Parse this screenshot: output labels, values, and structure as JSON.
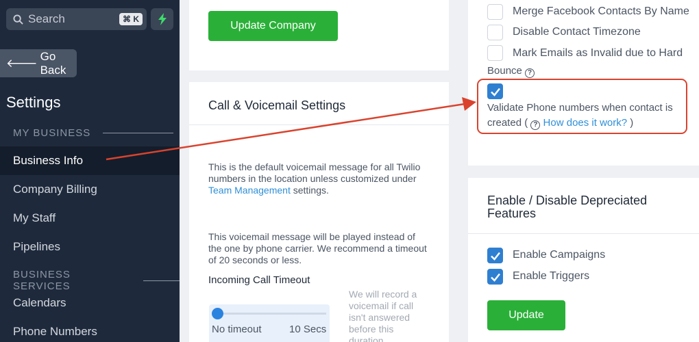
{
  "sidebar": {
    "search_placeholder": "Search",
    "search_shortcut": "⌘ K",
    "go_back": "Go Back",
    "settings_title": "Settings",
    "section_my_business": "MY BUSINESS",
    "section_business_services": "BUSINESS SERVICES",
    "items": [
      {
        "label": "Business Info",
        "active": true
      },
      {
        "label": "Company Billing"
      },
      {
        "label": "My Staff"
      },
      {
        "label": "Pipelines"
      },
      {
        "label": "Calendars"
      },
      {
        "label": "Phone Numbers"
      }
    ]
  },
  "company": {
    "update_button": "Update Company"
  },
  "call_settings": {
    "title": "Call & Voicemail Settings",
    "para1_prefix": "This is the default voicemail message for all Twilio numbers in the location unless customized under ",
    "para1_link": "Team Management",
    "para1_suffix": " settings.",
    "para2": "This voicemail message will be played instead of the one by phone carrier. We recommend a timeout of 20 seconds or less.",
    "timeout_label": "Incoming Call Timeout",
    "timeout_help": "We will record a voicemail if call isn't answered before this duration",
    "slider_min": "No timeout",
    "slider_max": "10 Secs",
    "slider_value": 0
  },
  "contact_settings": {
    "merge_facebook": "Merge Facebook Contacts By Name",
    "disable_timezone": "Disable Contact Timezone",
    "mark_invalid_line1": "Mark Emails as Invalid due to Hard",
    "mark_invalid_line2": "Bounce",
    "validate_line1": "Validate Phone numbers when contact is",
    "validate_line2_prefix": "created ( ",
    "validate_link": "How does it work?",
    "validate_line2_suffix": " )",
    "validate_checked": true
  },
  "depreciated": {
    "title": "Enable / Disable Depreciated Features",
    "enable_campaigns": "Enable Campaigns",
    "enable_triggers": "Enable Triggers",
    "update_button": "Update"
  },
  "colors": {
    "sidebar_bg": "#1e2a3c",
    "accent_green": "#2ab038",
    "checkbox_blue": "#2f7fd1",
    "annotation_red": "#d9432e",
    "link_blue": "#2f8fd8"
  }
}
